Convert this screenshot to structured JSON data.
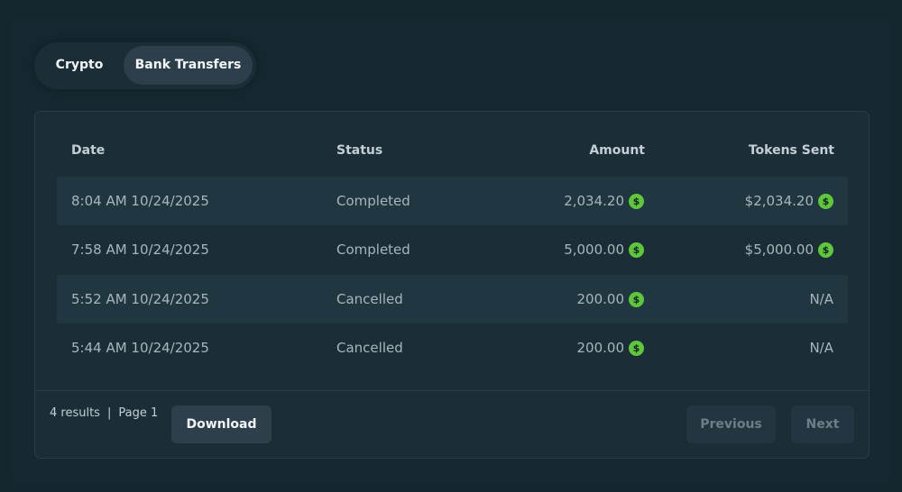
{
  "tabs": [
    {
      "label": "Crypto",
      "active": false
    },
    {
      "label": "Bank Transfers",
      "active": true
    }
  ],
  "table": {
    "columns": [
      "Date",
      "Status",
      "Amount",
      "Tokens Sent"
    ],
    "rows": [
      {
        "date": "8:04 AM 10/24/2025",
        "status": "Completed",
        "amount": "2,034.20",
        "tokens": "$2,034.20"
      },
      {
        "date": "7:58 AM 10/24/2025",
        "status": "Completed",
        "amount": "5,000.00",
        "tokens": "$5,000.00"
      },
      {
        "date": "5:52 AM 10/24/2025",
        "status": "Cancelled",
        "amount": "200.00",
        "tokens": "N/A"
      },
      {
        "date": "5:44 AM 10/24/2025",
        "status": "Cancelled",
        "amount": "200.00",
        "tokens": "N/A"
      }
    ]
  },
  "footer": {
    "results": "4 results",
    "separator": "|",
    "page": "Page 1",
    "download_label": "Download",
    "previous_label": "Previous",
    "next_label": "Next"
  },
  "icons": {
    "currency_icon": "dollar-coin-icon",
    "currency_glyph": "$",
    "currency_color": "#5fc83a"
  },
  "colors": {
    "background": "#15262f",
    "card": "#1b2e38",
    "row_alt": "#203641",
    "active_tab": "#2c3f4b",
    "text_primary": "#f1f5f8",
    "text_muted": "#a9b5bd"
  }
}
